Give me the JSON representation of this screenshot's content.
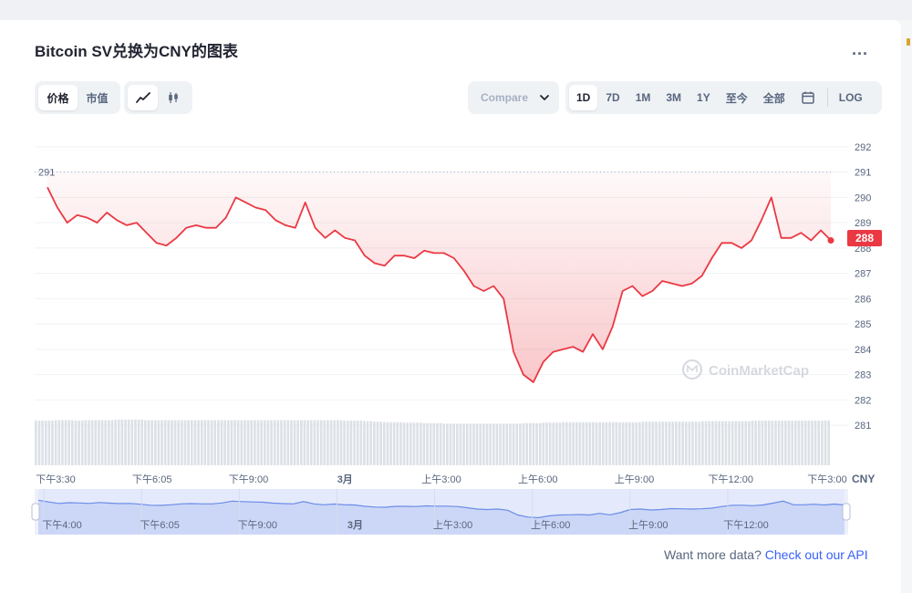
{
  "header": {
    "title": "Bitcoin SV兑换为CNY的图表",
    "more_label": "..."
  },
  "toolbar": {
    "price_tabs": [
      {
        "label": "价格",
        "active": true
      },
      {
        "label": "市值",
        "active": false
      }
    ],
    "chart_types": [
      {
        "icon": "line-chart-icon",
        "active": true
      },
      {
        "icon": "candlestick-icon",
        "active": false
      }
    ],
    "compare_label": "Compare",
    "ranges": [
      {
        "label": "1D",
        "active": true
      },
      {
        "label": "7D",
        "active": false
      },
      {
        "label": "1M",
        "active": false
      },
      {
        "label": "3M",
        "active": false
      },
      {
        "label": "1Y",
        "active": false
      },
      {
        "label": "至今",
        "active": false
      },
      {
        "label": "全部",
        "active": false
      }
    ],
    "calendar_icon": "calendar-icon",
    "log_label": "LOG"
  },
  "footer": {
    "prefix": "Want more data?",
    "link": "Check out our API"
  },
  "chart_data": {
    "type": "area",
    "line_color": "#ea3943",
    "y_ticks": [
      292,
      291,
      290,
      289,
      288,
      287,
      286,
      285,
      284,
      283,
      282,
      281
    ],
    "ylim": [
      280.5,
      292.5
    ],
    "y_unit": "CNY",
    "current_price": 288,
    "open_reference": 291,
    "watermark": "CoinMarketCap",
    "x_ticks": [
      "下午3:30",
      "下午6:05",
      "下午9:00",
      "3月",
      "上午3:00",
      "上午6:00",
      "上午9:00",
      "下午12:00",
      "下午3:00"
    ],
    "values": [
      290.4,
      289.6,
      289.0,
      289.3,
      289.2,
      289.0,
      289.4,
      289.1,
      288.9,
      289.0,
      288.6,
      288.2,
      288.1,
      288.4,
      288.8,
      288.9,
      288.8,
      288.8,
      289.2,
      290.0,
      289.8,
      289.6,
      289.5,
      289.1,
      288.9,
      288.8,
      289.8,
      288.8,
      288.4,
      288.7,
      288.4,
      288.3,
      287.7,
      287.4,
      287.3,
      287.7,
      287.7,
      287.6,
      287.9,
      287.8,
      287.8,
      287.6,
      287.1,
      286.5,
      286.3,
      286.5,
      286.0,
      283.9,
      283.0,
      282.7,
      283.5,
      283.9,
      284.0,
      284.1,
      283.9,
      284.6,
      284.0,
      284.9,
      286.3,
      286.5,
      286.1,
      286.3,
      286.7,
      286.6,
      286.5,
      286.6,
      286.9,
      287.6,
      288.2,
      288.2,
      288.0,
      288.3,
      289.1,
      290.0,
      288.4,
      288.4,
      288.6,
      288.3,
      288.7,
      288.3
    ],
    "volume": [
      0.89,
      0.89,
      0.9,
      0.9,
      0.89,
      0.9,
      0.9,
      0.9,
      0.91,
      0.91,
      0.91,
      0.9,
      0.9,
      0.9,
      0.9,
      0.9,
      0.9,
      0.9,
      0.9,
      0.9,
      0.9,
      0.9,
      0.9,
      0.9,
      0.9,
      0.9,
      0.9,
      0.9,
      0.9,
      0.9,
      0.9,
      0.89,
      0.89,
      0.88,
      0.87,
      0.86,
      0.86,
      0.85,
      0.85,
      0.84,
      0.84,
      0.83,
      0.83,
      0.83,
      0.83,
      0.83,
      0.83,
      0.83,
      0.83,
      0.84,
      0.84,
      0.85,
      0.85,
      0.86,
      0.86,
      0.86,
      0.86,
      0.86,
      0.86,
      0.86,
      0.86,
      0.87,
      0.87,
      0.87,
      0.87,
      0.87,
      0.87,
      0.88,
      0.88,
      0.88,
      0.88,
      0.88,
      0.89,
      0.89,
      0.89,
      0.89,
      0.89,
      0.89,
      0.89,
      0.89
    ],
    "navigator": {
      "x_ticks": [
        "下午4:00",
        "下午6:05",
        "下午9:00",
        "3月",
        "上午3:00",
        "上午6:00",
        "上午9:00",
        "下午12:00"
      ]
    }
  }
}
